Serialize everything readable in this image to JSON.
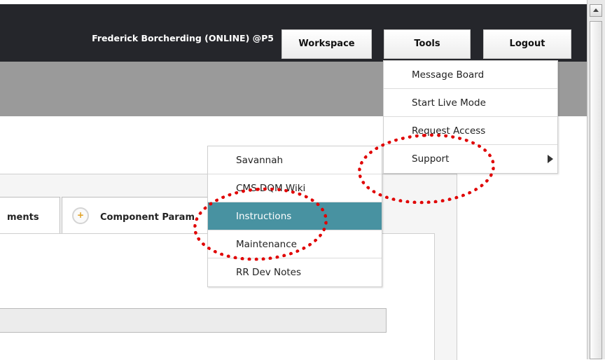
{
  "header": {
    "user_label": "Frederick Borcherding (ONLINE) @P5",
    "buttons": {
      "workspace": "Workspace",
      "tools": "Tools",
      "logout": "Logout"
    }
  },
  "tools_menu": {
    "items": [
      {
        "label": "Message Board"
      },
      {
        "label": "Start Live Mode"
      },
      {
        "label": "Request Access"
      },
      {
        "label": "Support",
        "has_submenu": true
      }
    ]
  },
  "support_submenu": {
    "items": [
      {
        "label": "Savannah"
      },
      {
        "label": "CMS DQM Wiki"
      },
      {
        "label": "Instructions",
        "active": true
      },
      {
        "label": "Maintenance"
      },
      {
        "label": "RR Dev Notes"
      }
    ]
  },
  "tabs": [
    {
      "label": "ments"
    },
    {
      "label": "Component Param",
      "icon": "plus-circle-icon"
    }
  ],
  "colors": {
    "topbar": "#25262b",
    "graybar": "#9a9a9a",
    "menu_active": "#4892a1",
    "highlight": "#e00000"
  }
}
